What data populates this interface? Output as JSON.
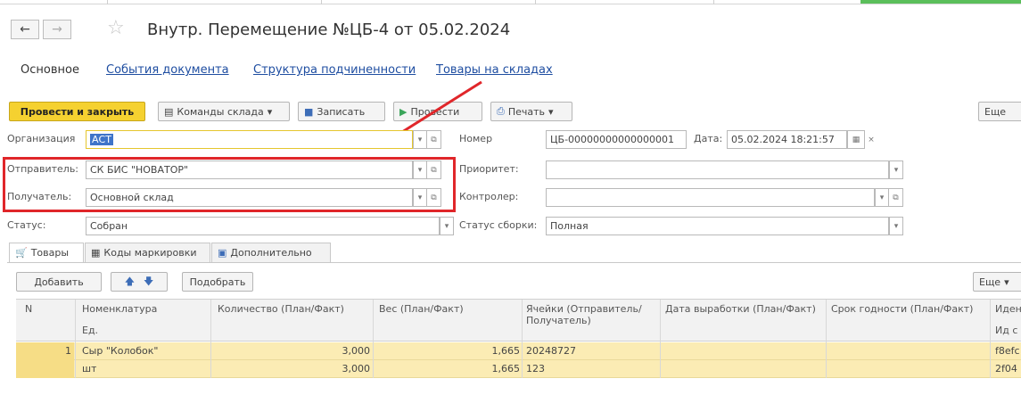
{
  "nav": {
    "back_icon": "←",
    "forward_icon": "→"
  },
  "window": {
    "title": "Внутр. Перемещение №ЦБ-4 от 05.02.2024"
  },
  "tabs": [
    {
      "label": "Основное"
    },
    {
      "label": "События документа"
    },
    {
      "label": "Структура подчиненности"
    },
    {
      "label": "Товары на складах"
    }
  ],
  "toolbar": {
    "post_close": "Провести и закрыть",
    "warehouse_commands": "Команды склада",
    "save": "Записать",
    "post": "Провести",
    "print": "Печать",
    "more": "Еще"
  },
  "form": {
    "org_label": "Организация",
    "org_value": "АСТ",
    "number_label": "Номер",
    "number_value": "ЦБ-00000000000000001",
    "date_label": "Дата:",
    "date_value": "05.02.2024 18:21:57",
    "sender_label": "Отправитель:",
    "sender_value": "СК БИС \"НОВАТОР\"",
    "priority_label": "Приоритет:",
    "priority_value": "",
    "receiver_label": "Получатель:",
    "receiver_value": "Основной склад",
    "controller_label": "Контролер:",
    "controller_value": "",
    "status_label": "Статус:",
    "status_value": "Собран",
    "assembly_label": "Статус сборки:",
    "assembly_value": "Полная"
  },
  "subtabs": [
    {
      "label": "Товары"
    },
    {
      "label": "Коды маркировки"
    },
    {
      "label": "Дополнительно"
    }
  ],
  "table_toolbar": {
    "add": "Добавить",
    "select": "Подобрать",
    "more": "Еще"
  },
  "table": {
    "headers": {
      "n": "N",
      "nomenclature": "Номенклатура",
      "unit": "Ед.",
      "quantity": "Количество (План/Факт)",
      "weight": "Вес (План/Факт)",
      "cells_l1": "Ячейки (Отправитель/",
      "cells_l2": "Получатель)",
      "prod_date": "Дата выработки (План/Факт)",
      "expiry": "Срок годности (План/Факт)",
      "id_l1": "Иден",
      "id_l2": "Ид с"
    },
    "rows": [
      {
        "n": "1",
        "nomenclature": "Сыр \"Колобок\"",
        "quantity": "3,000",
        "weight": "1,665",
        "cells": "20248727",
        "id": "f8efc"
      },
      {
        "n": "",
        "nomenclature": "шт",
        "quantity": "3,000",
        "weight": "1,665",
        "cells": "123",
        "id": "2f04"
      }
    ]
  },
  "colors": {
    "primary_button": "#f5d130",
    "highlight_box": "#e0262a",
    "row_highlight": "#fbecb4",
    "link": "#1f4ea1"
  }
}
